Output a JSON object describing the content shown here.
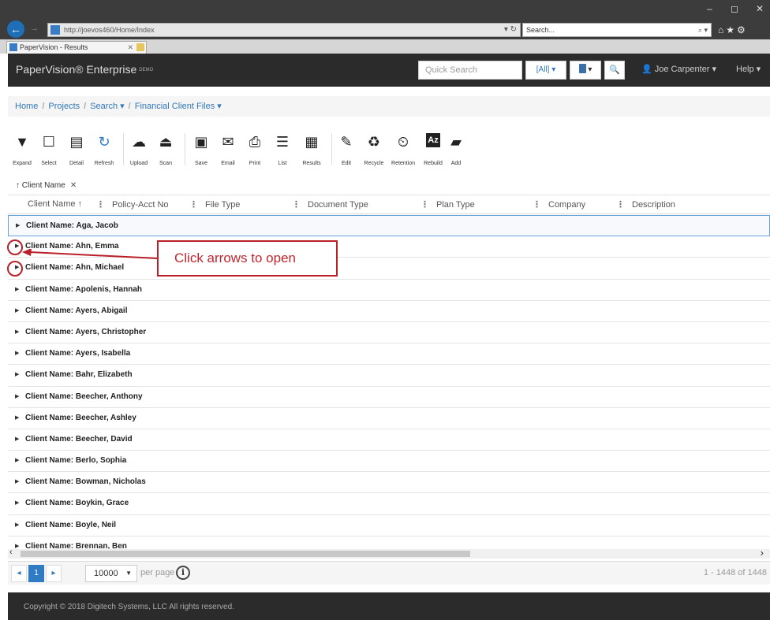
{
  "browser": {
    "url": "http://joevos460/Home/Index",
    "search_placeholder": "Search...",
    "tab_title": "PaperVision - Results",
    "minimize": "–",
    "restore": "◻",
    "close": "✕",
    "toolbar_icons": "⌂★⚙"
  },
  "app": {
    "brand": "PaperVision® Enterprise",
    "brand_tag": "DEMO",
    "quick_search_placeholder": "Quick Search",
    "scope": "[All] ▾",
    "device_caret": "▾",
    "search_glyph": "🔍",
    "user": "Joe Carpenter ▾",
    "help": "Help ▾"
  },
  "breadcrumb": {
    "home": "Home",
    "projects": "Projects",
    "search": "Search ▾",
    "project": "Financial Client Files ▾"
  },
  "toolbar": {
    "expand": "Expand",
    "select": "Select",
    "detail": "Detail",
    "refresh": "Refresh",
    "upload": "Upload",
    "scan": "Scan",
    "save": "Save",
    "email": "Email",
    "print": "Print",
    "list": "List",
    "results": "Results",
    "edit": "Edit",
    "recycle": "Recycle",
    "retention": "Retention",
    "rebuild": "Rebuild",
    "add": "Add"
  },
  "grouping": {
    "chip": "↑ Client Name",
    "remove": "✕"
  },
  "columns": {
    "client_name": "Client Name ↑",
    "policy": "Policy-Acct No",
    "file_type": "File Type",
    "document_type": "Document Type",
    "plan_type": "Plan Type",
    "company": "Company",
    "description": "Description"
  },
  "rows": [
    "Client Name: Aga, Jacob",
    "Client Name: Ahn, Emma",
    "Client Name: Ahn, Michael",
    "Client Name: Apolenis, Hannah",
    "Client Name: Ayers, Abigail",
    "Client Name: Ayers, Christopher",
    "Client Name: Ayers, Isabella",
    "Client Name: Bahr, Elizabeth",
    "Client Name: Beecher, Anthony",
    "Client Name: Beecher, Ashley",
    "Client Name: Beecher, David",
    "Client Name: Berlo, Sophia",
    "Client Name: Bowman, Nicholas",
    "Client Name: Boykin, Grace",
    "Client Name: Boyle, Neil",
    "Client Name: Brennan, Ben"
  ],
  "annotation": {
    "callout": "Click arrows to open"
  },
  "pager": {
    "prev": "◂",
    "page": "1",
    "next": "▸",
    "page_size": "10000",
    "per_page": "per page",
    "range": "1 - 1448 of 1448"
  },
  "footer": {
    "copyright": "Copyright © 2018 Digitech Systems, LLC All rights reserved."
  },
  "colors": {
    "accent": "#2f7cc4",
    "annotation": "#b9202a",
    "header_bg": "#2b2b2b"
  }
}
